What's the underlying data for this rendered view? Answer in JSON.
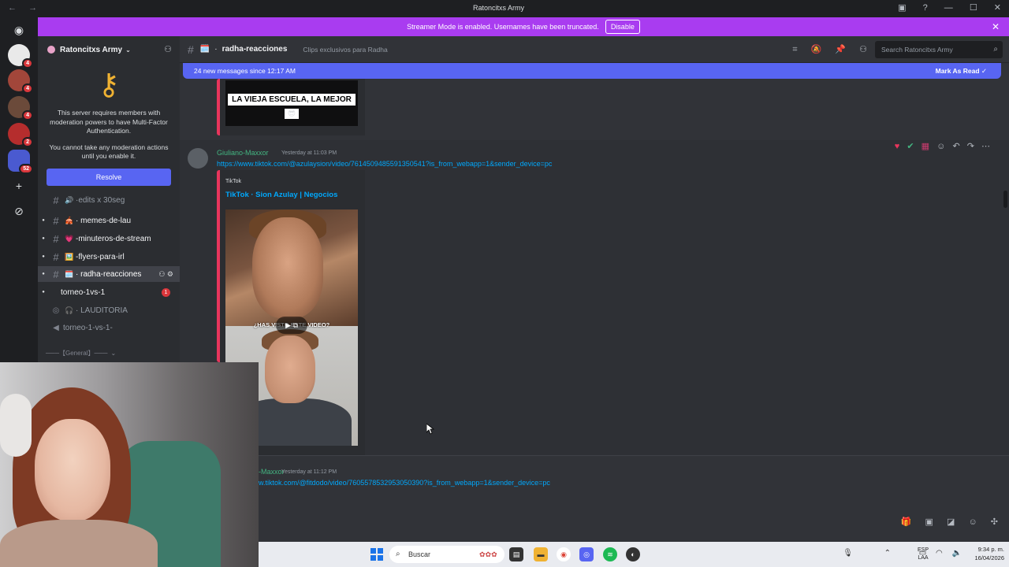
{
  "titlebar": {
    "title": "Ratoncitxs Army",
    "back": "←",
    "forward": "→",
    "min": "—",
    "max": "☐",
    "close": "✕"
  },
  "banner": {
    "text": "Streamer Mode is enabled. Usernames have been truncated.",
    "button": "Disable",
    "close": "✕"
  },
  "rail": {
    "badges": [
      "15",
      "4",
      "4",
      "4",
      "2",
      "52"
    ]
  },
  "server": {
    "name": "Ratoncitxs Army"
  },
  "mfa": {
    "line1": "This server requires members with moderation powers to have Multi-Factor Authentication.",
    "line2": "You cannot take any moderation actions until you enable it.",
    "button": "Resolve"
  },
  "channels": [
    {
      "name": "·edits x 30seg",
      "emoji": "🔊"
    },
    {
      "name": "· memes-de-lau",
      "emoji": "🎪"
    },
    {
      "name": "-minuteros-de-stream",
      "emoji": "💗"
    },
    {
      "name": "-flyers-para-irl",
      "emoji": "🖼️"
    },
    {
      "name": "· radha-reacciones",
      "emoji": "🗓️"
    },
    {
      "name": "torneo-1vs-1",
      "unread": "1"
    },
    {
      "name": "· LAUDITORIA",
      "emoji": "🎧"
    },
    {
      "name": "torneo-1-vs-1-"
    },
    {
      "name": "───【General】───"
    }
  ],
  "header": {
    "channel": "radha-reacciones",
    "topic": "Clips exclusivos para Radha",
    "search_placeholder": "Search Ratoncitxs Army"
  },
  "newbar": {
    "text": "24 new messages since 12:17 AM",
    "mark": "Mark As Read"
  },
  "messages": [
    {
      "caption": "LA VIEJA ESCUELA, LA MEJOR",
      "caption_emoji": "😎"
    },
    {
      "author": "Giuliano-Maxxor",
      "time": "Yesterday at 11:03 PM",
      "link": "https://www.tiktok.com/@azulaysion/video/7614509485591350541?is_from_webapp=1&sender_device=pc",
      "provider": "TikTok",
      "embed_title": "TikTok · Sion Azulay | Negocios",
      "video_caption": "¿HAS VISTO ESTE VIDEO?"
    },
    {
      "author": "-Maxxor",
      "time": "Yesterday at 11:12 PM",
      "link": "w.tiktok.com/@fitdodo/video/7605578532953050390?is_from_webapp=1&sender_device=pc"
    }
  ],
  "taskbar": {
    "search": "Buscar",
    "lang1": "ESP",
    "lang2": "LAA",
    "time": "9:34 p. m.",
    "date": "16/04/2026"
  }
}
